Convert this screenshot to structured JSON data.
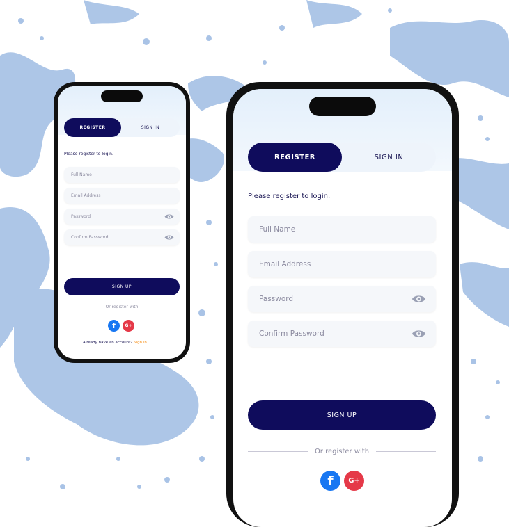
{
  "auth": {
    "tab_register": "REGISTER",
    "tab_signin": "SIGN IN",
    "prompt": "Please register to login.",
    "fields": {
      "full_name": "Full Name",
      "email": "Email Address",
      "password": "Password",
      "confirm_password": "Confirm Password"
    },
    "signup_button": "SIGN UP",
    "or_register_with": "Or register with",
    "social": {
      "facebook": "f",
      "google": "G+"
    },
    "already_have_account": "Already have an account?",
    "signin_link": "Sign in"
  },
  "colors": {
    "brand_navy": "#0f0c5c",
    "link_orange": "#f7931e",
    "facebook": "#1877f2",
    "google": "#e53948",
    "map_blue": "#a9c3e6"
  },
  "icons": {
    "password_toggle": "eye-icon"
  }
}
